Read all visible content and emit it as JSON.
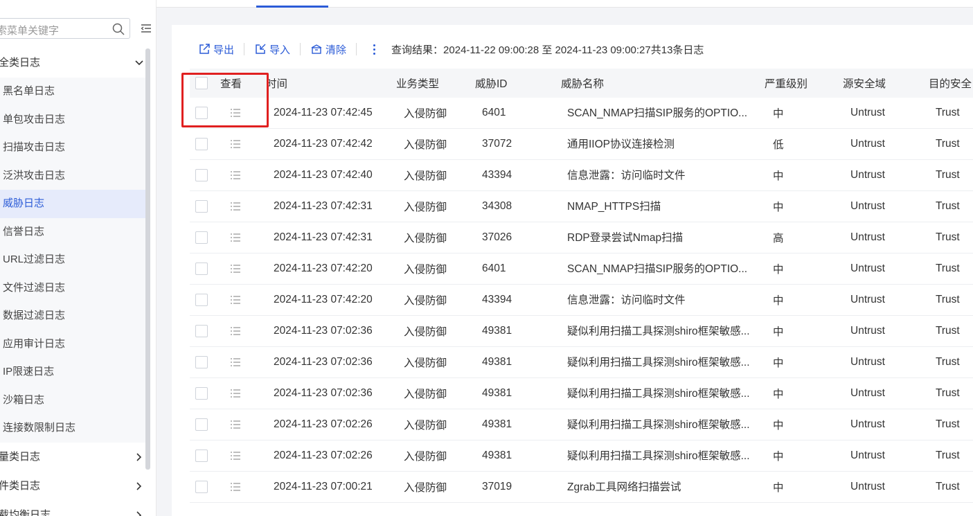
{
  "sidebar": {
    "search_placeholder": "索菜单关键字",
    "group_all": "全类日志",
    "items": [
      {
        "label": "黑名单日志"
      },
      {
        "label": "单包攻击日志"
      },
      {
        "label": "扫描攻击日志"
      },
      {
        "label": "泛洪攻击日志"
      },
      {
        "label": "威胁日志",
        "active": true
      },
      {
        "label": "信誉日志"
      },
      {
        "label": "URL过滤日志"
      },
      {
        "label": "文件过滤日志"
      },
      {
        "label": "数据过滤日志"
      },
      {
        "label": "应用审计日志"
      },
      {
        "label": "IP限速日志"
      },
      {
        "label": "沙箱日志"
      },
      {
        "label": "连接数限制日志"
      }
    ],
    "group_flow": "量类日志",
    "group_event": "件类日志",
    "group_lb": "载均衡日志"
  },
  "toolbar": {
    "export_label": "导出",
    "import_label": "导入",
    "clear_label": "清除",
    "result_text": "查询结果：2024-11-22 09:00:28 至 2024-11-23 09:00:27共13条日志"
  },
  "table": {
    "headers": {
      "view": "查看",
      "time": "时间",
      "type": "业务类型",
      "id": "威胁ID",
      "name": "威胁名称",
      "severity": "严重级别",
      "src": "源安全域",
      "dst": "目的安全"
    },
    "rows": [
      {
        "time": "2024-11-23 07:42:45",
        "type": "入侵防御",
        "id": "6401",
        "name": "SCAN_NMAP扫描SIP服务的OPTIO...",
        "severity": "中",
        "src": "Untrust",
        "dst": "Trust"
      },
      {
        "time": "2024-11-23 07:42:42",
        "type": "入侵防御",
        "id": "37072",
        "name": "通用IIOP协议连接检测",
        "severity": "低",
        "src": "Untrust",
        "dst": "Trust"
      },
      {
        "time": "2024-11-23 07:42:40",
        "type": "入侵防御",
        "id": "43394",
        "name": "信息泄露：访问临时文件",
        "severity": "中",
        "src": "Untrust",
        "dst": "Trust"
      },
      {
        "time": "2024-11-23 07:42:31",
        "type": "入侵防御",
        "id": "34308",
        "name": "NMAP_HTTPS扫描",
        "severity": "中",
        "src": "Untrust",
        "dst": "Trust"
      },
      {
        "time": "2024-11-23 07:42:31",
        "type": "入侵防御",
        "id": "37026",
        "name": "RDP登录尝试Nmap扫描",
        "severity": "高",
        "src": "Untrust",
        "dst": "Trust"
      },
      {
        "time": "2024-11-23 07:42:20",
        "type": "入侵防御",
        "id": "6401",
        "name": "SCAN_NMAP扫描SIP服务的OPTIO...",
        "severity": "中",
        "src": "Untrust",
        "dst": "Trust"
      },
      {
        "time": "2024-11-23 07:42:20",
        "type": "入侵防御",
        "id": "43394",
        "name": "信息泄露：访问临时文件",
        "severity": "中",
        "src": "Untrust",
        "dst": "Trust"
      },
      {
        "time": "2024-11-23 07:02:36",
        "type": "入侵防御",
        "id": "49381",
        "name": "疑似利用扫描工具探测shiro框架敏感...",
        "severity": "中",
        "src": "Untrust",
        "dst": "Trust"
      },
      {
        "time": "2024-11-23 07:02:36",
        "type": "入侵防御",
        "id": "49381",
        "name": "疑似利用扫描工具探测shiro框架敏感...",
        "severity": "中",
        "src": "Untrust",
        "dst": "Trust"
      },
      {
        "time": "2024-11-23 07:02:36",
        "type": "入侵防御",
        "id": "49381",
        "name": "疑似利用扫描工具探测shiro框架敏感...",
        "severity": "中",
        "src": "Untrust",
        "dst": "Trust"
      },
      {
        "time": "2024-11-23 07:02:26",
        "type": "入侵防御",
        "id": "49381",
        "name": "疑似利用扫描工具探测shiro框架敏感...",
        "severity": "中",
        "src": "Untrust",
        "dst": "Trust"
      },
      {
        "time": "2024-11-23 07:02:26",
        "type": "入侵防御",
        "id": "49381",
        "name": "疑似利用扫描工具探测shiro框架敏感...",
        "severity": "中",
        "src": "Untrust",
        "dst": "Trust"
      },
      {
        "time": "2024-11-23 07:00:21",
        "type": "入侵防御",
        "id": "37019",
        "name": "Zgrab工具网络扫描尝试",
        "severity": "中",
        "src": "Untrust",
        "dst": "Trust"
      }
    ]
  },
  "colors": {
    "accent": "#2b5bd7",
    "highlight_box": "#e02020",
    "active_bg": "#e6ebfb"
  }
}
